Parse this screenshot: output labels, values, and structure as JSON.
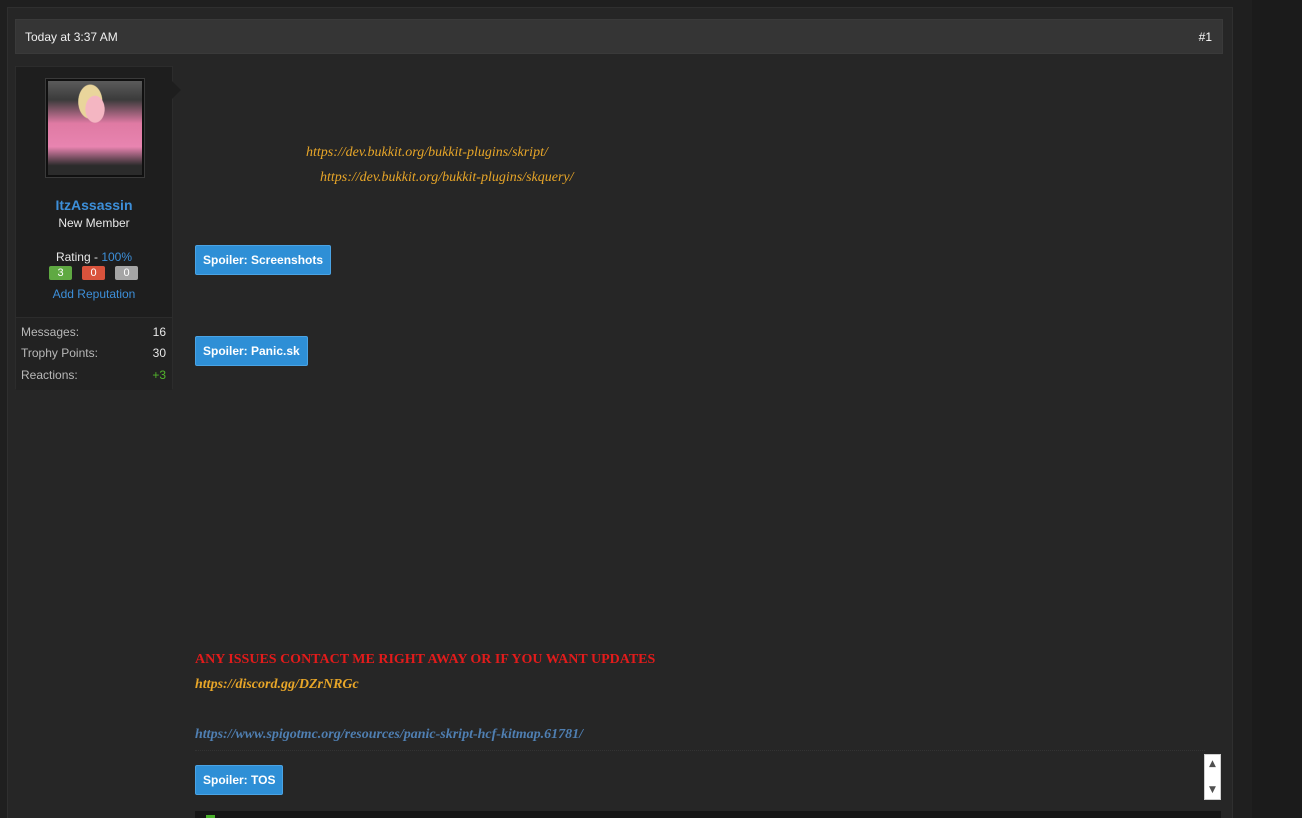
{
  "post": {
    "date": "Today at 3:37 AM",
    "number": "#1"
  },
  "user": {
    "name": "ItzAssassin",
    "title": "New Member",
    "rating_label": "Rating - ",
    "rating_value": "100%",
    "rep_positive": "3",
    "rep_negative": "0",
    "rep_neutral": "0",
    "add_reputation": "Add Reputation",
    "stats": [
      {
        "label": "Messages:",
        "value": "16"
      },
      {
        "label": "Trophy Points:",
        "value": "30"
      },
      {
        "label": "Reactions:",
        "value": "+3"
      }
    ]
  },
  "message": {
    "links": {
      "skript": "https://dev.bukkit.org/bukkit-plugins/skript/",
      "skquery": "https://dev.bukkit.org/bukkit-plugins/skquery/"
    },
    "spoilers": {
      "screenshots": "Spoiler: Screenshots",
      "panic": "Spoiler: Panic.sk",
      "tos": "Spoiler: TOS"
    },
    "issues": "ANY ISSUES CONTACT ME RIGHT AWAY OR IF YOU WANT UPDATES",
    "discord": "https://discord.gg/DZrNRGc",
    "spigot": "https://www.spigotmc.org/resources/panic-skript-hcf-kitmap.61781/"
  },
  "colors": {
    "accent_blue": "#3d8fd9",
    "spoiler_blue": "#2e8fd6",
    "link_orange": "#e8a628",
    "alert_red": "#e21b1b"
  },
  "icons": {
    "scroll_up": "▲",
    "scroll_down": "▼"
  }
}
